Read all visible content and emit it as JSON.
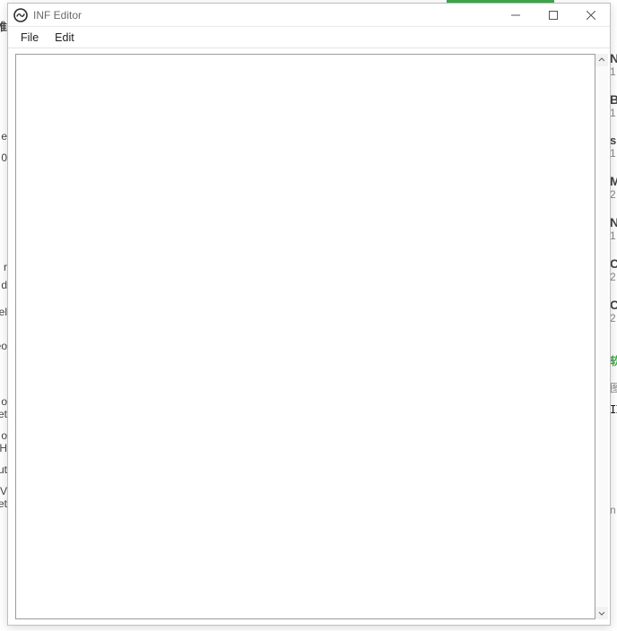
{
  "window": {
    "title": "INF Editor",
    "controls": {
      "minimize": "minimize",
      "maximize": "maximize",
      "close": "close"
    }
  },
  "menu": {
    "file": "File",
    "edit": "Edit"
  },
  "editor": {
    "content": ""
  },
  "background": {
    "left": [
      "推",
      "e",
      "0",
      "r",
      "d",
      "el",
      "eo",
      "o",
      "et",
      "o",
      "H",
      "ut",
      "V",
      "et"
    ],
    "right": [
      "N",
      "1",
      "B",
      "1",
      "s",
      "1",
      "M",
      "2",
      "N",
      "1",
      "C",
      "2",
      "C",
      "2",
      "软",
      "图",
      "III",
      "n"
    ],
    "top_green": "▬"
  }
}
